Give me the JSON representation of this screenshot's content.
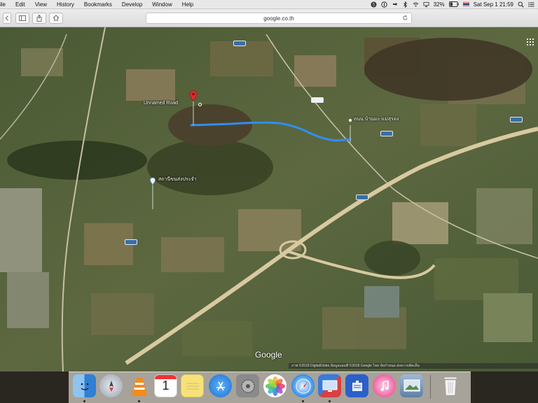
{
  "menubar": {
    "items": [
      "ile",
      "Edit",
      "View",
      "History",
      "Bookmarks",
      "Develop",
      "Window",
      "Help"
    ],
    "status": {
      "battery": "32%",
      "clock": "Sat Sep 1  21:59"
    }
  },
  "toolbar": {
    "url": "google.co.th"
  },
  "map": {
    "pin_label": "Unnamed Road",
    "place_label_right": "ถนน บ้านมะ-แม่สุรอง",
    "place_label_left": "สถานีขนส่งประจำ",
    "logo": "Google",
    "attribution": "ภาพ ©2018 DigitalGlobe,ข้อมูลแผนที่ ©2018 Google   ไทย   ข้อกำหนด   ส่งความคิดเห็น"
  },
  "dock": {
    "apps": [
      {
        "name": "Finder",
        "icon": "finder-icon",
        "color": "#3a86d8"
      },
      {
        "name": "Launchpad",
        "icon": "launchpad-icon",
        "color": "#c9ced6"
      },
      {
        "name": "VLC",
        "icon": "vlc-icon",
        "color": "#f28a18"
      },
      {
        "name": "Calendar",
        "icon": "calendar-icon",
        "color": "#ffffff"
      },
      {
        "name": "Notes",
        "icon": "notes-icon",
        "color": "#f4d35e"
      },
      {
        "name": "App Store",
        "icon": "app-store-icon",
        "color": "#2f8ee8"
      },
      {
        "name": "System Preferences",
        "icon": "system-preferences-icon",
        "color": "#8c8c8c"
      },
      {
        "name": "Photos",
        "icon": "photos-icon",
        "color": "#ffffff"
      },
      {
        "name": "Safari",
        "icon": "safari-icon",
        "color": "#2d8cea"
      },
      {
        "name": "Remote Desktop",
        "icon": "remote-desktop-icon",
        "color": "#d73a3a"
      },
      {
        "name": "Notifier",
        "icon": "notifier-icon",
        "color": "#2d5fc9"
      },
      {
        "name": "iTunes",
        "icon": "itunes-icon",
        "color": "#f05a9e"
      },
      {
        "name": "Preview",
        "icon": "preview-icon",
        "color": "#6b8fb3"
      },
      {
        "name": "Trash",
        "icon": "trash-icon",
        "color": "#d8d8d8"
      }
    ],
    "calendar_day": "1"
  }
}
